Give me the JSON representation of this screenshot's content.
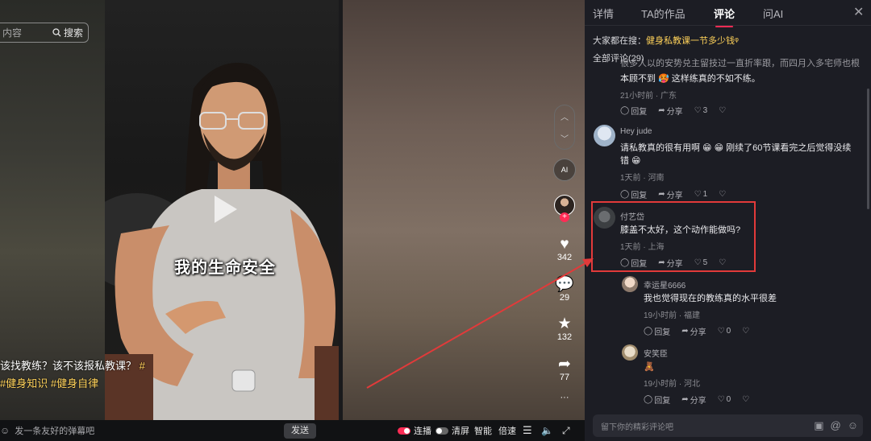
{
  "search": {
    "placeholder": "内容",
    "button": "搜索"
  },
  "video": {
    "caption": "我的生命安全",
    "desc_text": "该找教练？该不该报私教课？",
    "tags": [
      "#",
      "#健身知识",
      "#健身自律"
    ]
  },
  "actions": {
    "ai_label": "AI",
    "likes": "342",
    "comments": "29",
    "favorites": "132",
    "shares": "77",
    "more": "···",
    "follow": "+"
  },
  "player_bar": {
    "danmu_placeholder": "发一条友好的弹幕吧",
    "send": "发送",
    "autoplay": "连播",
    "clear": "清屏",
    "smart": "智能",
    "speed": "倍速"
  },
  "panel": {
    "tabs": [
      "详情",
      "TA的作品",
      "评论",
      "问AI"
    ],
    "active_tab": "评论",
    "trending_prefix": "大家都在搜：",
    "trending_keyword": "健身私教课一节多少钱",
    "comment_count": "全部评论(29)",
    "reply_label": "回复",
    "share_label": "分享",
    "input_placeholder": "留下你的精彩评论吧",
    "comments": [
      {
        "name": "",
        "text_line1": "很多人以的安势兑主留技过一直折率跟，而四月入多宅师也根",
        "text_line2": "本顾不到 🥵 这样练真的不如不练。",
        "meta": "21小时前 · 广东",
        "likes": "3"
      },
      {
        "name": "Hey jude",
        "text_line1": "请私教真的很有用啊 😁 😁  刚续了60节课看完之后觉得没续",
        "text_line2": "错 😁",
        "meta": "1天前 · 河南",
        "likes": "1"
      },
      {
        "name": "付艺岱",
        "text_line1": "膝盖不太好，这个动作能做吗?",
        "text_line2": "",
        "meta": "1天前 · 上海",
        "likes": "5"
      }
    ],
    "replies": [
      {
        "name": "幸运星6666",
        "text": "我也觉得现在的教练真的水平很差",
        "meta": "19小时前 · 福建",
        "likes": "0"
      },
      {
        "name": "安笑臣",
        "text": "🧸",
        "meta": "19小时前 · 河北",
        "likes": "0"
      }
    ]
  },
  "colors": {
    "accent": "#fe2c55",
    "highlight": "#e23a3a",
    "tag": "#ffd25a",
    "panel_bg": "#1c1d24"
  }
}
